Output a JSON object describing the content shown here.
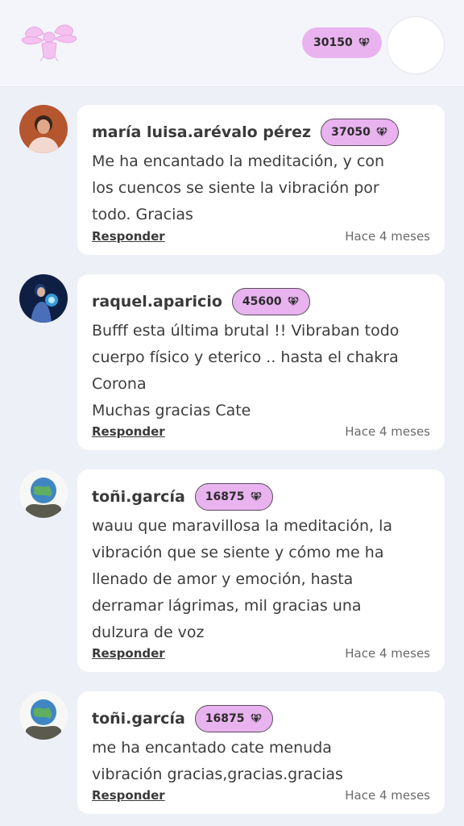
{
  "header": {
    "gems": "30150",
    "logo_icon": "angel-wings-logo",
    "profile_icon": "avatar-placeholder"
  },
  "colors": {
    "badge_bg": "#e9b3ef",
    "card_bg": "#ffffff",
    "page_bg": "#eef0f7"
  },
  "comments": [
    {
      "author": "maría luisa.arévalo pérez",
      "gems": "37050",
      "text": "Me ha encantado la meditación, y con\nlos cuencos se siente la vibración por\ntodo. Gracias",
      "reply_label": "Responder",
      "time": "Hace 4 meses"
    },
    {
      "author": "raquel.aparicio",
      "gems": "45600",
      "text": "Bufff esta última brutal !! Vibraban todo\ncuerpo físico y eterico .. hasta el chakra\nCorona\nMuchas gracias Cate",
      "reply_label": "Responder",
      "time": "Hace 4 meses"
    },
    {
      "author": "toñi.garcía",
      "gems": "16875",
      "text": "wauu que maravillosa la meditación, la\nvibración que se siente y cómo me ha\nllenado de amor y emoción, hasta\nderramar lágrimas, mil gracias una\ndulzura de voz",
      "reply_label": "Responder",
      "time": "Hace 4 meses"
    },
    {
      "author": "toñi.garcía",
      "gems": "16875",
      "text": "me ha encantado cate menuda\nvibración gracias,gracias.gracias",
      "reply_label": "Responder",
      "time": "Hace 4 meses"
    }
  ]
}
